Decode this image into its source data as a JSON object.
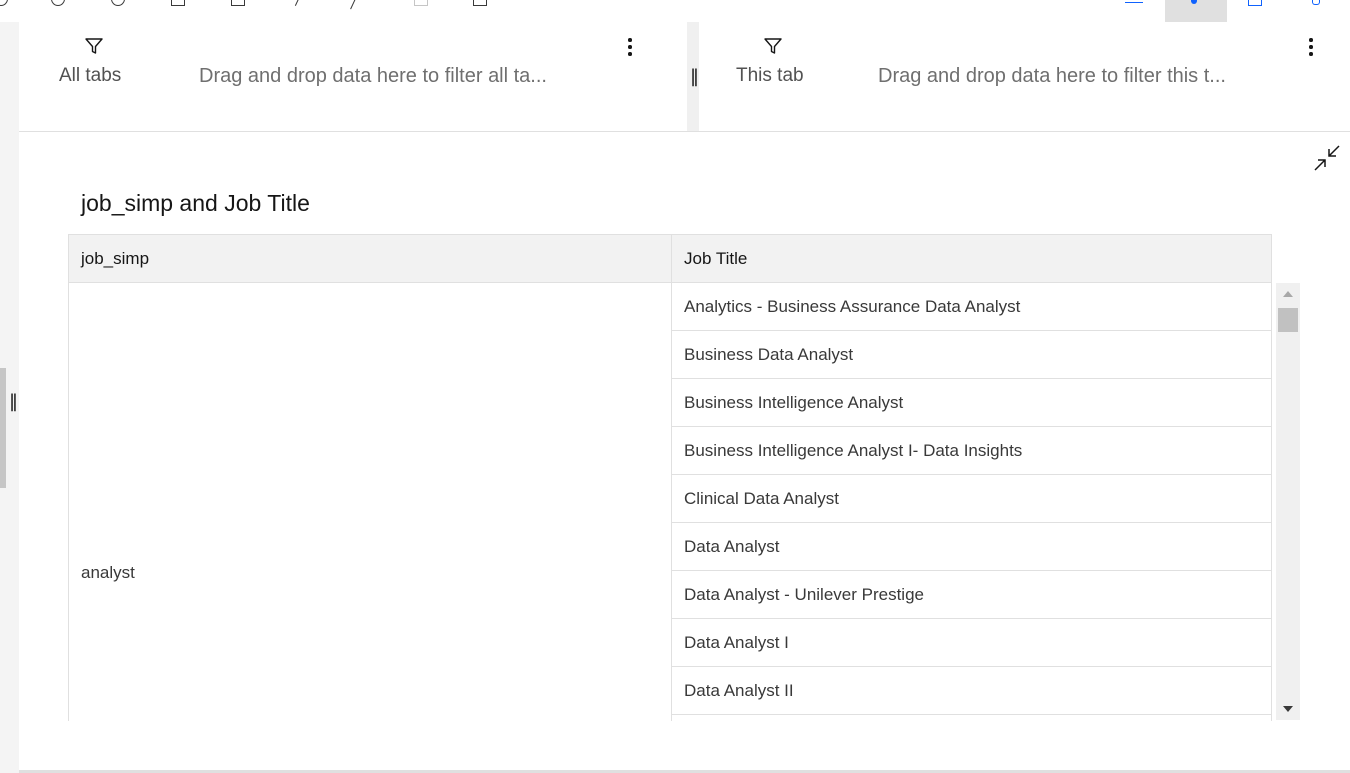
{
  "toolbar": {
    "icons": [
      "undo-icon",
      "redo-icon",
      "info-icon",
      "data-icon",
      "table-icon",
      "pen-icon",
      "undo2-icon",
      "blank-icon",
      "copy-icon",
      "chart-icon",
      "user-icon",
      "grid-icon",
      "pin-icon"
    ]
  },
  "filters": {
    "all_tabs": {
      "label": "All tabs",
      "placeholder": "Drag and drop data here to filter all ta..."
    },
    "this_tab": {
      "label": "This tab",
      "placeholder": "Drag and drop data here to filter this t..."
    }
  },
  "widget": {
    "title": "job_simp and Job Title",
    "columns": [
      "job_simp",
      "Job Title"
    ],
    "group_value": "analyst",
    "rows": [
      "Analytics - Business Assurance Data Analyst",
      "Business Data Analyst",
      "Business Intelligence Analyst",
      "Business Intelligence Analyst I- Data Insights",
      "Clinical Data Analyst",
      "Data Analyst",
      "Data Analyst - Unilever Prestige",
      "Data Analyst I",
      "Data Analyst II"
    ]
  },
  "colors": {
    "accent": "#0f62fe",
    "header_bg": "#f2f2f2",
    "border": "#e0e0e0"
  }
}
